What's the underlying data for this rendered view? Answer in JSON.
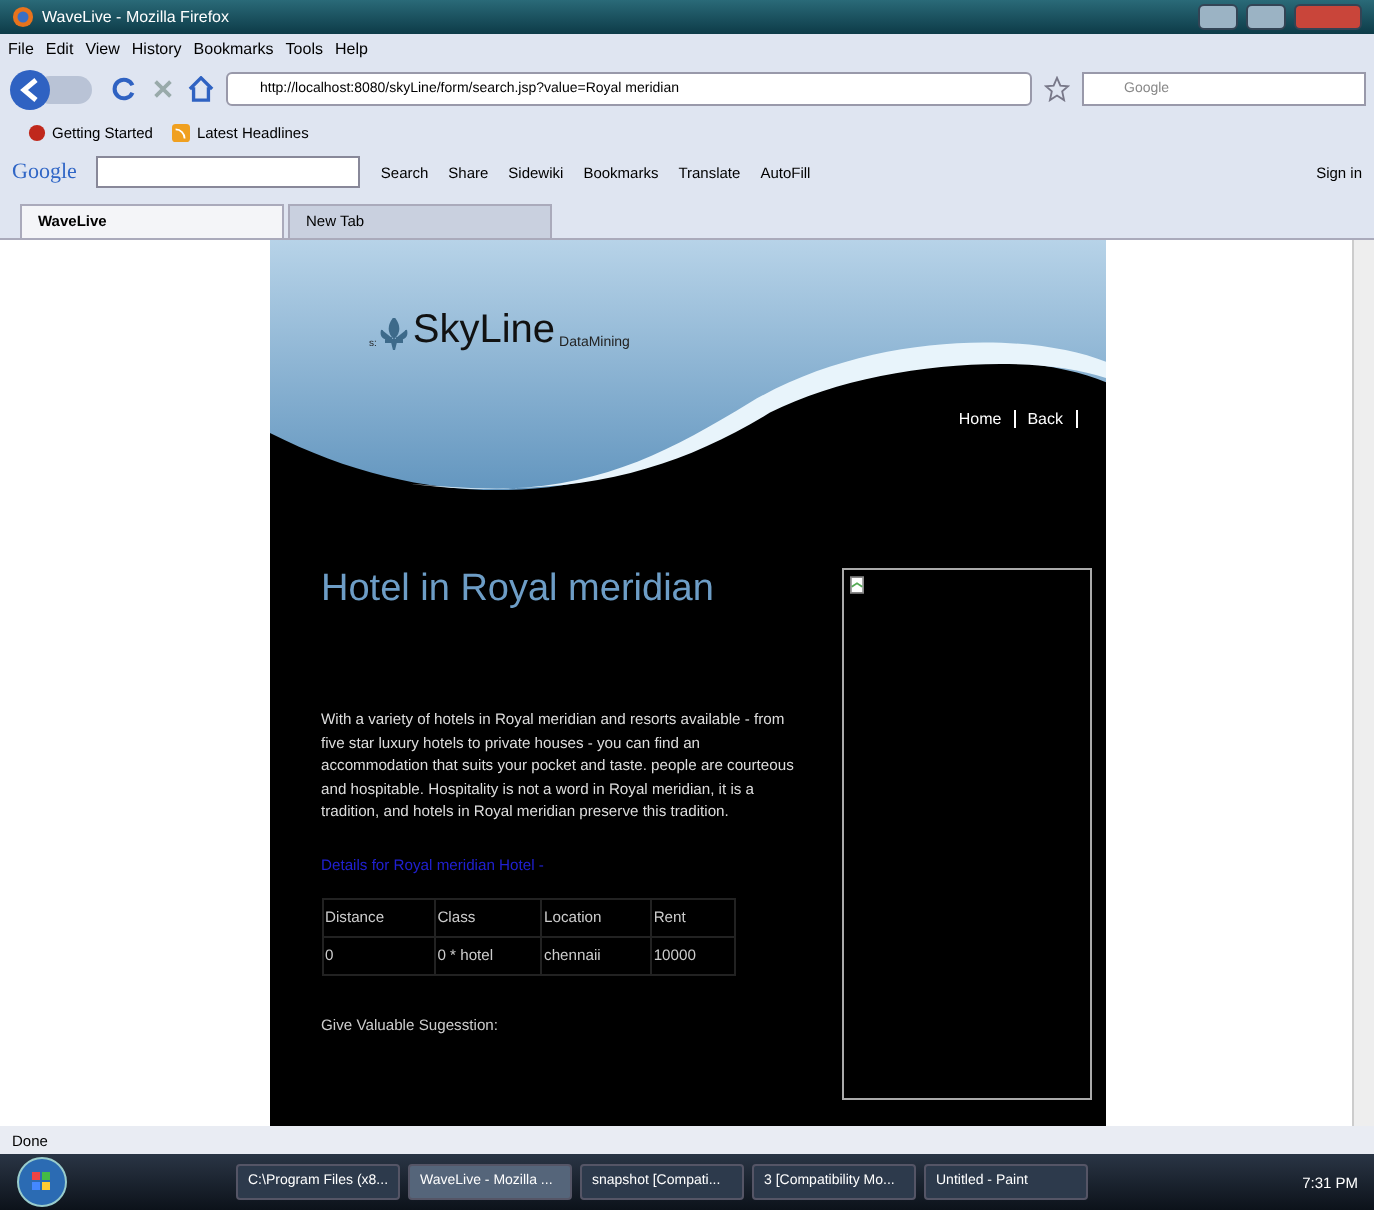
{
  "window": {
    "title": "WaveLive - Mozilla Firefox"
  },
  "menu": [
    "File",
    "Edit",
    "View",
    "History",
    "Bookmarks",
    "Tools",
    "Help"
  ],
  "address": {
    "value": "http://localhost:8080/skyLine/form/search.jsp?value=Royal meridian"
  },
  "search": {
    "placeholder": "Google"
  },
  "bookmarks": [
    {
      "label": "Getting Started",
      "kind": "firefox"
    },
    {
      "label": "Latest Headlines",
      "kind": "feed"
    }
  ],
  "google_toolbar": {
    "logo": "Google",
    "items": [
      "Search",
      "Share",
      "Sidewiki",
      "Bookmarks",
      "Translate",
      "AutoFill"
    ],
    "sign_in": "Sign in"
  },
  "tabs": [
    {
      "label": "WaveLive",
      "selected": true
    },
    {
      "label": "New Tab",
      "selected": false
    }
  ],
  "page": {
    "logo_prefix": "s:",
    "logo": "SkyLine",
    "logo_sub": "DataMining",
    "nav": [
      "Home",
      "Back"
    ],
    "heading": "Hotel in Royal meridian",
    "description": "With a variety of hotels in Royal meridian and resorts available - from five star luxury hotels to private houses - you can find an accommodation that suits your pocket and taste. people are courteous and hospitable. Hospitality is not a word in Royal meridian, it is a tradition, and hotels in Royal meridian preserve this tradition.",
    "details_link": "Details for Royal meridian Hotel -",
    "table": {
      "columns": [
        "Distance",
        "Class",
        "Location",
        "Rent"
      ],
      "rows": [
        [
          "0",
          "0 * hotel",
          "chennaii",
          "10000"
        ]
      ]
    },
    "suggestion": "Give Valuable Sugesstion:"
  },
  "status_bar": {
    "text": "Done"
  },
  "taskbar": {
    "items": [
      {
        "label": "C:\\Program Files (x8...",
        "selected": false
      },
      {
        "label": "WaveLive - Mozilla ...",
        "selected": true
      },
      {
        "label": "snapshot [Compati...",
        "selected": false
      },
      {
        "label": "3 [Compatibility Mo...",
        "selected": false
      },
      {
        "label": "Untitled - Paint",
        "selected": false
      }
    ],
    "clock": "7:31 PM"
  }
}
